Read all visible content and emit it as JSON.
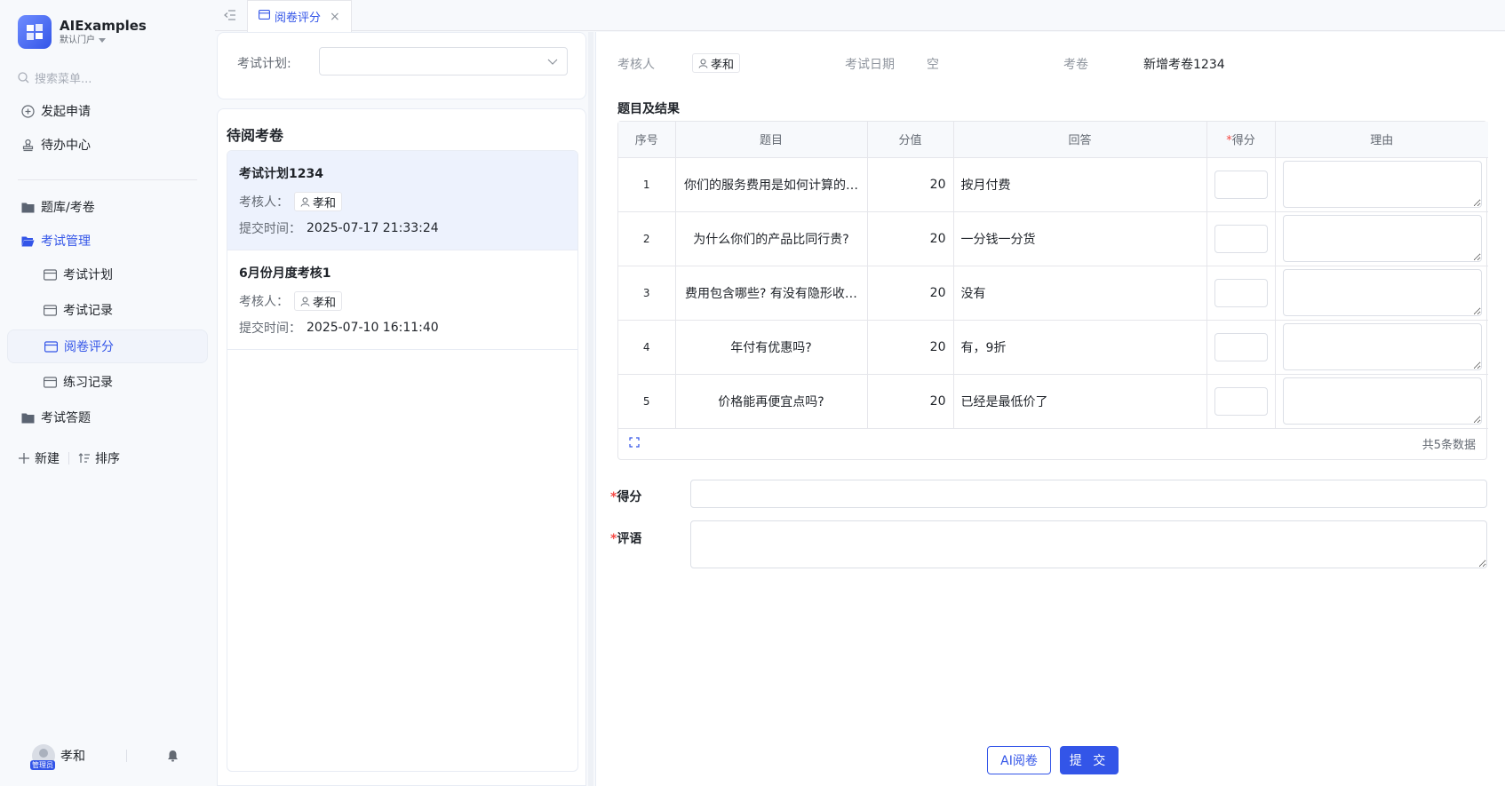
{
  "brand": {
    "name": "AIExamples",
    "portal": "默认门户"
  },
  "sidebar": {
    "search_placeholder": "搜索菜单...",
    "items": [
      {
        "label": "发起申请",
        "icon": "plus-circle-icon"
      },
      {
        "label": "待办中心",
        "icon": "stamp-icon"
      },
      {
        "label": "题库/考卷",
        "icon": "folder-icon"
      },
      {
        "label": "考试管理",
        "icon": "folder-open-icon"
      },
      {
        "label": "考试计划",
        "icon": "window-icon"
      },
      {
        "label": "考试记录",
        "icon": "window-icon"
      },
      {
        "label": "阅卷评分",
        "icon": "window-icon"
      },
      {
        "label": "练习记录",
        "icon": "window-icon"
      },
      {
        "label": "考试答题",
        "icon": "folder-icon"
      }
    ],
    "actions": {
      "new": "新建",
      "sort": "排序"
    },
    "user": {
      "name": "孝和",
      "role": "管理员"
    }
  },
  "tabs": [
    {
      "label": "阅卷评分"
    }
  ],
  "plan_filter": {
    "label": "考试计划:",
    "value": ""
  },
  "pending": {
    "title": "待阅考卷",
    "reviewer_label": "考核人：",
    "submit_label": "提交时间：",
    "papers": [
      {
        "title": "考试计划1234",
        "reviewer": "孝和",
        "submitted": "2025-07-17 21:33:24"
      },
      {
        "title": "6月份月度考核1",
        "reviewer": "孝和",
        "submitted": "2025-07-10 16:11:40"
      }
    ]
  },
  "detail": {
    "reviewer_label": "考核人",
    "reviewer": "孝和",
    "date_label": "考试日期",
    "date": "空",
    "paper_label": "考卷",
    "paper": "新增考卷1234",
    "section_title": "题目及结果",
    "columns": {
      "no": "序号",
      "question": "题目",
      "value": "分值",
      "answer": "回答",
      "score": "得分",
      "reason": "理由"
    },
    "rows": [
      {
        "no": "1",
        "question": "你们的服务费用是如何计算的…",
        "value": "20",
        "answer": "按月付费"
      },
      {
        "no": "2",
        "question": "为什么你们的产品比同行贵?",
        "value": "20",
        "answer": "一分钱一分货"
      },
      {
        "no": "3",
        "question": "费用包含哪些? 有没有隐形收…",
        "value": "20",
        "answer": "没有"
      },
      {
        "no": "4",
        "question": "年付有优惠吗?",
        "value": "20",
        "answer": "有，9折"
      },
      {
        "no": "5",
        "question": "价格能再便宜点吗?",
        "value": "20",
        "answer": "已经是最低价了"
      }
    ],
    "total_text": "共5条数据",
    "score_label": "得分",
    "comment_label": "评语",
    "required_mark": "*"
  },
  "buttons": {
    "ai_review": "AI阅卷",
    "submit": "提 交"
  },
  "colors": {
    "primary": "#3355e8",
    "required": "#f54a45",
    "selected_bg": "#edf2fd"
  }
}
